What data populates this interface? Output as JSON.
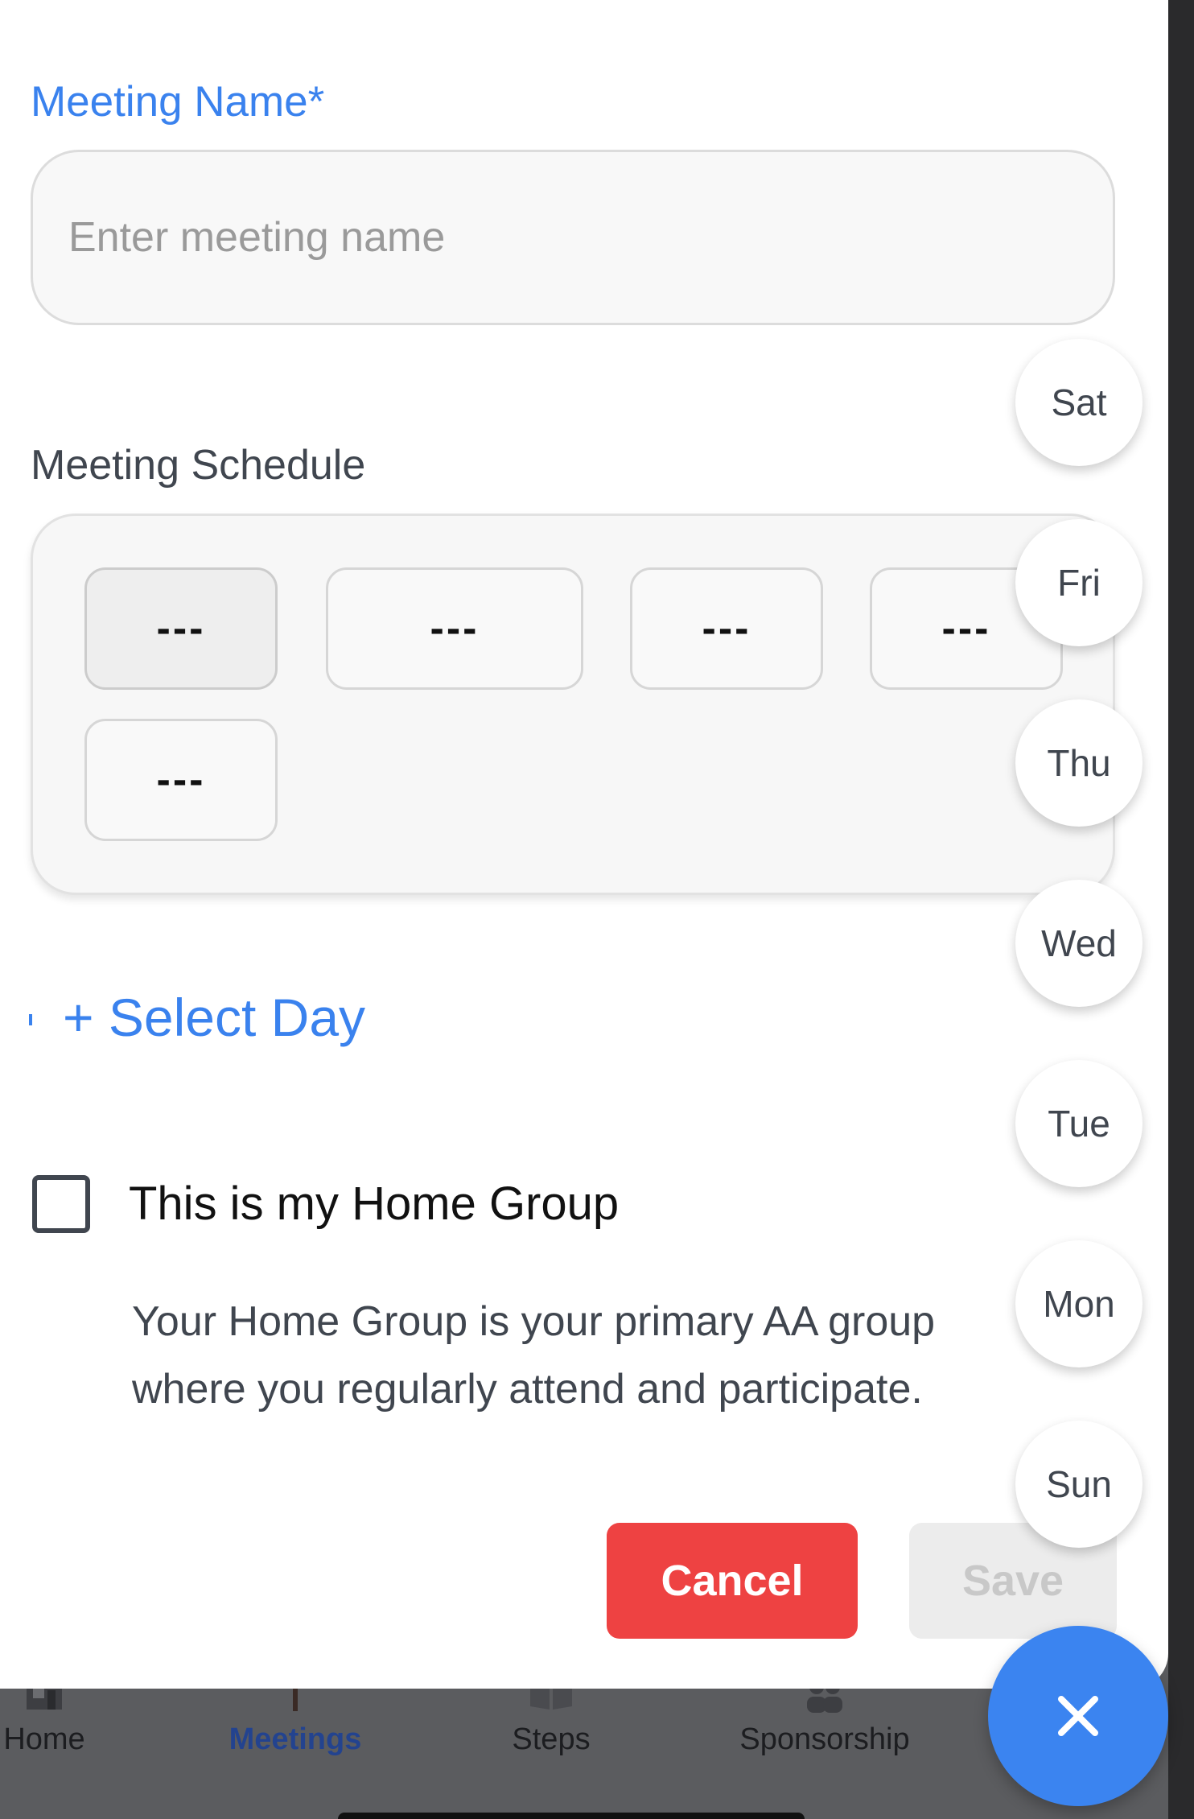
{
  "form": {
    "meeting_name_label": "Meeting Name*",
    "meeting_name_placeholder": "Enter meeting name",
    "meeting_name_value": "",
    "schedule_label": "Meeting Schedule",
    "schedule_slots": [
      "---",
      "---",
      "---",
      "---",
      "---"
    ],
    "select_day_label": "+ Select Day",
    "home_group_label": "This is my Home Group",
    "home_group_checked": false,
    "home_group_description": "Your Home Group is your primary AA group where you regularly attend and participate.",
    "cancel_label": "Cancel",
    "save_label": "Save"
  },
  "day_picker": {
    "days": [
      "Sat",
      "Fri",
      "Thu",
      "Wed",
      "Tue",
      "Mon",
      "Sun"
    ]
  },
  "fab": {
    "icon": "close-icon"
  },
  "tabs": [
    {
      "label": "Home",
      "icon": "home-icon",
      "active": false
    },
    {
      "label": "Meetings",
      "icon": "meetings-icon",
      "active": true
    },
    {
      "label": "Steps",
      "icon": "book-icon",
      "active": false
    },
    {
      "label": "Sponsorship",
      "icon": "people-icon",
      "active": false
    }
  ],
  "colors": {
    "accent": "#3a82ee",
    "danger": "#ee4242",
    "active_tab": "#23438f",
    "fab": "#3b84f0"
  }
}
